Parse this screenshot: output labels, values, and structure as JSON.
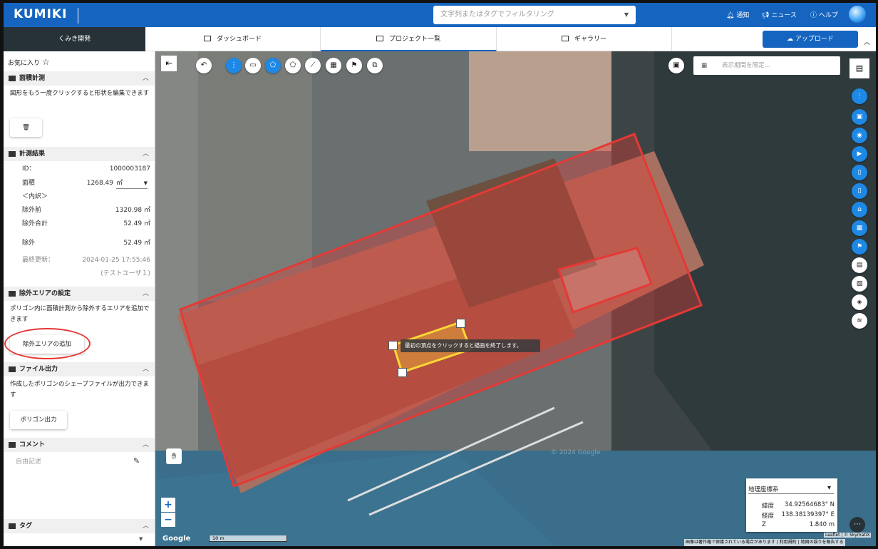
{
  "app": {
    "logo": "KUMIKI"
  },
  "header": {
    "search_placeholder": "文字列またはタグでフィルタリング",
    "links": [
      "通知",
      "ニュース",
      "ヘルプ"
    ]
  },
  "tabs": {
    "brand": "くみき開発",
    "items": [
      "ダッシュボード",
      "プロジェクト一覧",
      "ギャラリー"
    ],
    "upload": "アップロード"
  },
  "sidebar": {
    "favorite": "お気に入り",
    "area": {
      "title": "面積計測",
      "desc": "図形をもう一度クリックすると形状を編集できます"
    },
    "result": {
      "title": "計測結果",
      "id_label": "ID：",
      "id_value": "1000003187",
      "area_label": "面積",
      "area_value": "1268.49",
      "area_unit": "㎡",
      "breakdown": "＜内訳＞",
      "before_label": "除外前",
      "before_value": "1320.98 ㎡",
      "total_label": "除外合計",
      "total_value": "52.49 ㎡",
      "excl_label": "除外",
      "excl_value": "52.49 ㎡",
      "updated_label": "最終更新：",
      "updated_value": "2024-01-25 17:55:46",
      "user": "(テストユーザ１)"
    },
    "exclusion": {
      "title": "除外エリアの設定",
      "desc": "ポリゴン内に面積計測から除外するエリアを追加できます",
      "button": "除外エリアの追加"
    },
    "file": {
      "title": "ファイル出力",
      "desc": "作成したポリゴンのシェープファイルが出力できます",
      "button": "ポリゴン出力"
    },
    "comment": {
      "title": "コメント",
      "placeholder": "自由記述"
    },
    "tag": {
      "title": "タグ"
    }
  },
  "map": {
    "date_placeholder": "表示期間を限定...",
    "tooltip": "最初の頂点をクリックすると描画を終了します。",
    "watermark": "© 2024 Google",
    "scale": "10 m",
    "google": "Google",
    "attribution": "Leaflet | © SkymatiX",
    "footer": [
      "画像は著作権で保護されている場合があります",
      "利用規約",
      "地図の誤りを報告する"
    ],
    "coord": {
      "system": "地理座標系",
      "lat_label": "緯度",
      "lat": "34.92564683° N",
      "lon_label": "経度",
      "lon": "138.38139397° E",
      "z_label": "Z",
      "z": "1.840 m"
    }
  },
  "colors": {
    "brand": "#1565c0",
    "polygon": "#e53935",
    "exclusion": "#fdd835"
  }
}
